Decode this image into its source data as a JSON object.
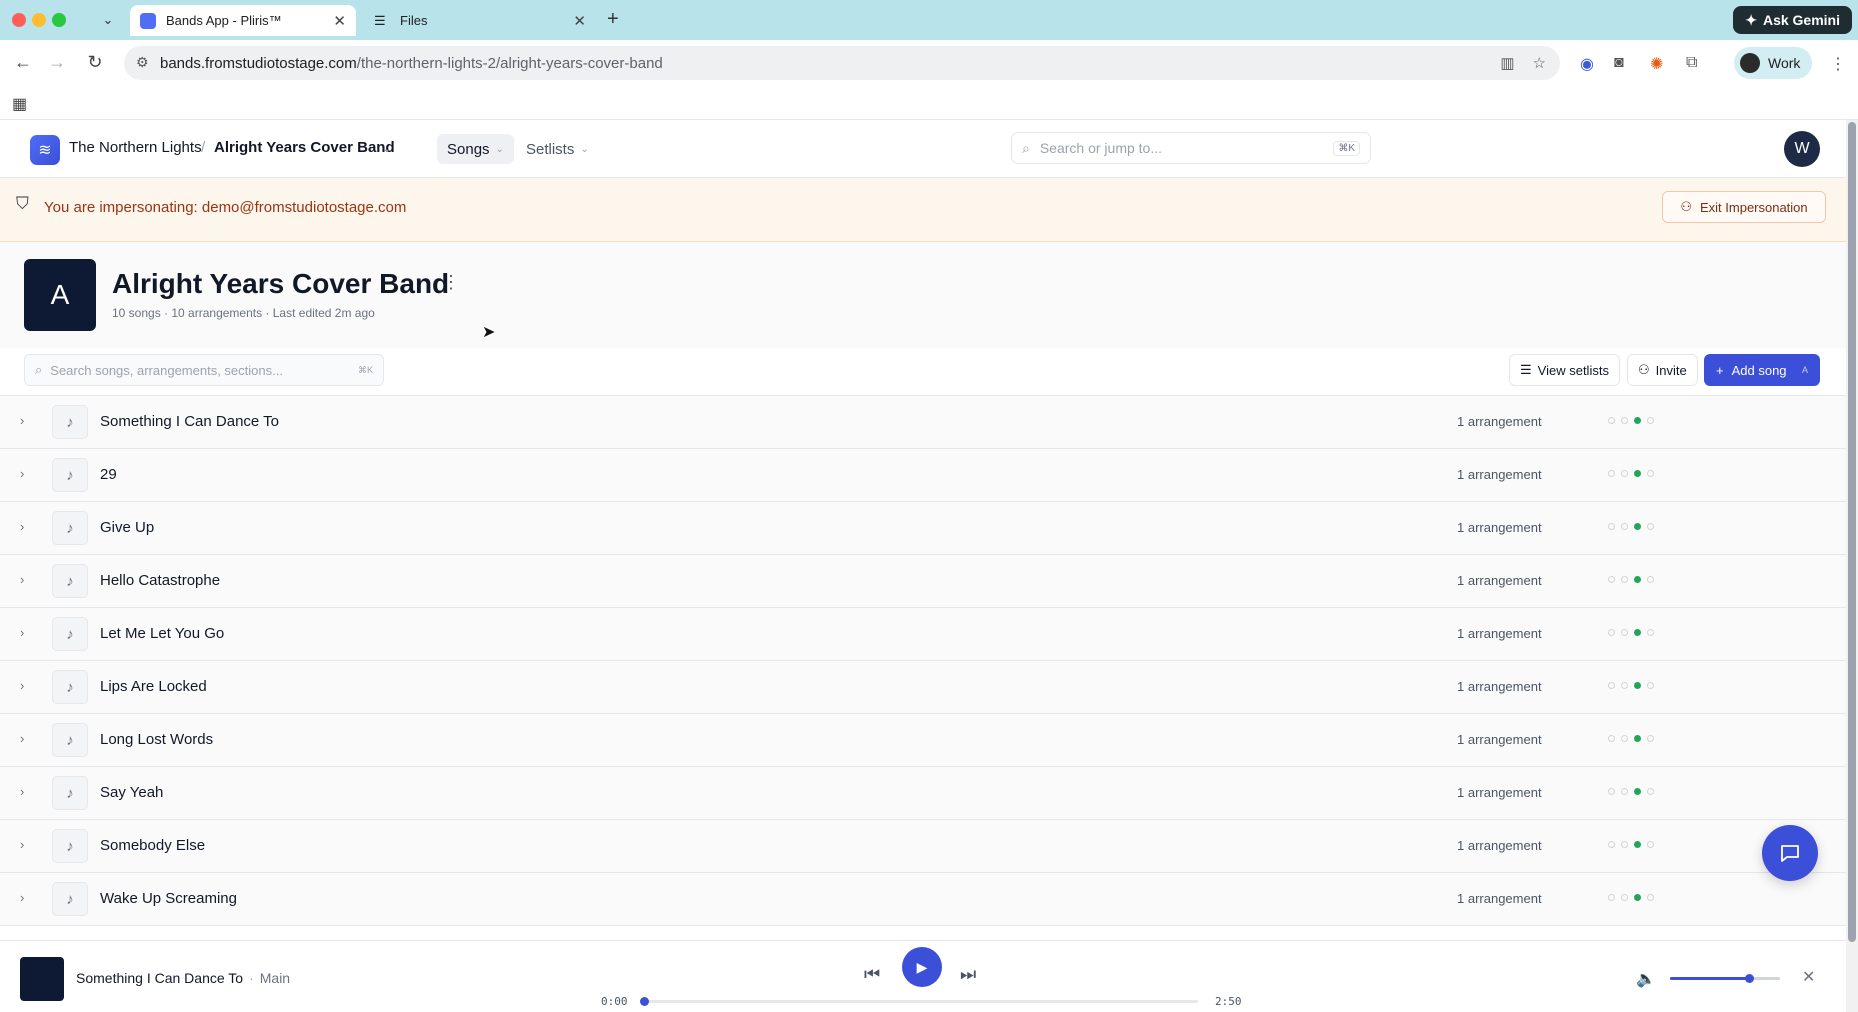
{
  "browser": {
    "tabs": [
      {
        "title": "Bands App - Pliris™",
        "active": true
      },
      {
        "title": "Files",
        "active": false
      }
    ],
    "ask_gemini": "Ask Gemini",
    "url_host": "bands.fromstudiotostage.com",
    "url_path": "/the-northern-lights-2/alright-years-cover-band",
    "profile_label": "Work"
  },
  "header": {
    "org": "The Northern Lights",
    "project": "Alright Years Cover Band",
    "nav": [
      {
        "label": "Songs",
        "active": true
      },
      {
        "label": "Setlists",
        "active": false
      }
    ],
    "search_placeholder": "Search or jump to...",
    "search_kbd": "⌘K",
    "user_initial": "W"
  },
  "banner": {
    "message": "You are impersonating: demo@fromstudiotostage.com",
    "exit_label": "Exit Impersonation"
  },
  "project": {
    "initial": "A",
    "title": "Alright Years Cover Band",
    "meta": "10 songs · 10 arrangements · Last edited 2m ago"
  },
  "actions": {
    "search_placeholder": "Search songs, arrangements, sections...",
    "search_kbd": "⌘K",
    "view_setlists": "View setlists",
    "invite": "Invite",
    "add_song": "Add song",
    "add_song_kbd": "A"
  },
  "songs": [
    {
      "name": "Something I Can Dance To",
      "arrangements": "1 arrangement",
      "status": [
        0,
        0,
        1,
        0
      ]
    },
    {
      "name": "29",
      "arrangements": "1 arrangement",
      "status": [
        0,
        0,
        1,
        0
      ]
    },
    {
      "name": "Give Up",
      "arrangements": "1 arrangement",
      "status": [
        0,
        0,
        1,
        0
      ]
    },
    {
      "name": "Hello Catastrophe",
      "arrangements": "1 arrangement",
      "status": [
        0,
        0,
        1,
        0
      ]
    },
    {
      "name": "Let Me Let You Go",
      "arrangements": "1 arrangement",
      "status": [
        0,
        0,
        1,
        0
      ]
    },
    {
      "name": "Lips Are Locked",
      "arrangements": "1 arrangement",
      "status": [
        0,
        0,
        1,
        0
      ]
    },
    {
      "name": "Long Lost Words",
      "arrangements": "1 arrangement",
      "status": [
        0,
        0,
        1,
        0
      ]
    },
    {
      "name": "Say Yeah",
      "arrangements": "1 arrangement",
      "status": [
        0,
        0,
        1,
        0
      ]
    },
    {
      "name": "Somebody Else",
      "arrangements": "1 arrangement",
      "status": [
        0,
        0,
        1,
        0
      ]
    },
    {
      "name": "Wake Up Screaming",
      "arrangements": "1 arrangement",
      "status": [
        0,
        0,
        1,
        0
      ]
    }
  ],
  "player": {
    "song": "Something I Can Dance To",
    "arrangement": "Main",
    "elapsed": "0:00",
    "duration": "2:50",
    "progress": 0.0,
    "volume": 0.72
  },
  "colors": {
    "accent": "#3b4fd8",
    "status_on": "#22a55b",
    "banner_text": "#9a3412"
  }
}
